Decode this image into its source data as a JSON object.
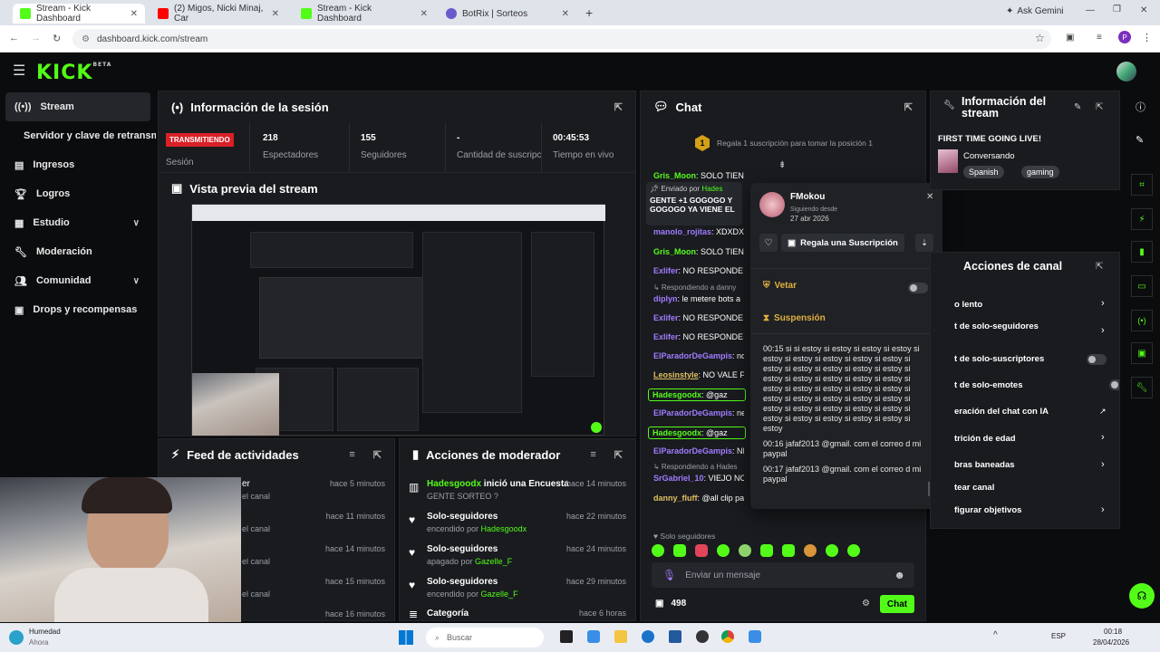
{
  "browser": {
    "tabs": [
      {
        "title": "Stream - Kick Dashboard",
        "color": "#53fc18"
      },
      {
        "title": "(2) Migos, Nicki Minaj, Car",
        "color": "#ff0000"
      },
      {
        "title": "Stream - Kick Dashboard",
        "color": "#53fc18"
      },
      {
        "title": "BotRix | Sorteos",
        "color": "#6a5acd"
      }
    ],
    "ask_gemini": "Ask Gemini",
    "url": "dashboard.kick.com/stream",
    "profile": "P"
  },
  "kick": {
    "logo": "KICK",
    "beta": "BETA"
  },
  "sidebar": {
    "items": [
      {
        "label": "Stream",
        "icon": "stream-icon"
      },
      {
        "label": "Servidor y clave de retransmisión",
        "icon": ""
      },
      {
        "label": "Ingresos",
        "icon": "chart-icon"
      },
      {
        "label": "Logros",
        "icon": "trophy-icon"
      },
      {
        "label": "Estudio",
        "icon": "studio-icon"
      },
      {
        "label": "Moderación",
        "icon": "wrench-icon"
      },
      {
        "label": "Comunidad",
        "icon": "people-icon"
      },
      {
        "label": "Drops y recompensas",
        "icon": "gift-icon"
      }
    ]
  },
  "session": {
    "title": "Información de la sesión",
    "live_badge": "TRANSMITIENDO",
    "session_label": "Sesión",
    "stats": [
      {
        "value": "218",
        "label": "Espectadores"
      },
      {
        "value": "155",
        "label": "Seguidores"
      },
      {
        "value": "-",
        "label": "Cantidad de suscripciones"
      },
      {
        "value": "00:45:53",
        "label": "Tiempo en vivo"
      }
    ]
  },
  "preview": {
    "title": "Vista previa del stream"
  },
  "feed": {
    "title": "Feed de actividades",
    "items": [
      {
        "l1": "er",
        "l2": "el canal",
        "time": "hace 5 minutos"
      },
      {
        "l1": "",
        "l2": "el canal",
        "time": "hace 11 minutos"
      },
      {
        "l1": "",
        "l2": "el canal",
        "time": "hace 14 minutos"
      },
      {
        "l1": "",
        "l2": "el canal",
        "time": "hace 15 minutos"
      },
      {
        "l1": "",
        "l2": "el canal",
        "time": "hace 16 minutos"
      }
    ]
  },
  "modactions": {
    "title": "Acciones de moderador",
    "items": [
      {
        "user": "Hadesgoodx",
        "action": " inició una Encuesta",
        "sub": "GENTE SORTEO ?",
        "subuser": "",
        "time": "hace 14 minutos"
      },
      {
        "user": "",
        "action": "Solo-seguidores",
        "sub": "encendido por ",
        "subuser": "Hadesgoodx",
        "time": "hace 22 minutos"
      },
      {
        "user": "",
        "action": "Solo-seguidores",
        "sub": "apagado por ",
        "subuser": "Gazelle_F",
        "time": "hace 24 minutos"
      },
      {
        "user": "",
        "action": "Solo-seguidores",
        "sub": "encendido por ",
        "subuser": "Gazelle_F",
        "time": "hace 29 minutos"
      },
      {
        "user": "",
        "action": "Categoría",
        "sub": "",
        "subuser": "",
        "time": "hace 6 horas"
      }
    ]
  },
  "chat": {
    "title": "Chat",
    "gift_rank": "1",
    "gift_text": "Regala 1 suscripción para tomar la posición 1",
    "pinned_by": "Enviado por",
    "pinned_user": "Hades",
    "pinned_msg1": "GENTE +1 GOGOGO Y",
    "pinned_msg2": "GOGOGO YA VIENE EL",
    "messages": [
      {
        "user": "Gris_Moon",
        "text": ": SOLO TIEN",
        "color": "#53fc18"
      },
      {
        "user": "manolo_rojitas",
        "text": ": XDXDX",
        "color": "#a17bff"
      },
      {
        "user": "Gris_Moon",
        "text": ": SOLO TIEN",
        "color": "#53fc18"
      },
      {
        "user": "Exlifer",
        "text": ": NO RESPONDE",
        "color": "#a17bff"
      },
      {
        "user": "↳ Respondiendo a danny",
        "text": "",
        "color": "#777"
      },
      {
        "user": "diplyn",
        "text": ": le metere bots a",
        "color": "#a17bff"
      },
      {
        "user": "Exlifer",
        "text": ": NO RESPONDE",
        "color": "#a17bff"
      },
      {
        "user": "Exlifer",
        "text": ": NO RESPONDE",
        "color": "#a17bff"
      },
      {
        "user": "ElParadorDeGampis",
        "text": ": no",
        "color": "#a17bff"
      },
      {
        "user": "Leosinstyle",
        "text": ": NO VALE F",
        "color": "#e0c060"
      },
      {
        "user": "Hadesgoodx",
        "text": ": @gaz",
        "color": "#53fc18"
      },
      {
        "user": "ElParadorDeGampis",
        "text": ": ne",
        "color": "#a17bff"
      },
      {
        "user": "Hadesgoodx",
        "text": ": @gaz",
        "color": "#53fc18"
      },
      {
        "user": "ElParadorDeGampis",
        "text": ": NI",
        "color": "#a17bff"
      },
      {
        "user": "↳ Respondiendo a Hades",
        "text": "",
        "color": "#777"
      },
      {
        "user": "SrGabriel_10",
        "text": ": VIEJO NO",
        "color": "#a17bff"
      },
      {
        "user": "danny_fluff",
        "text": ": @all clip pa",
        "color": "#e0c060"
      }
    ],
    "followers_only": "Solo seguidores",
    "input_placeholder": "Enviar un mensaje",
    "points": "498",
    "send": "Chat"
  },
  "usercard": {
    "name": "FMokou",
    "following_label": "Siguiendo desde",
    "following_date": "27 abr 2026",
    "gift_button": "Regala una Suscripción",
    "veto": "Vetar",
    "suspension": "Suspensión",
    "log": [
      {
        "text": "00:15 si si estoy si estoy si estoy si estoy si estoy si estoy si estoy si estoy si estoy si estoy si estoy si estoy si estoy si estoy si estoy si estoy si estoy si estoy si estoy si estoy si estoy si estoy si estoy si estoy si estoy si estoy si estoy si estoy si estoy si estoy si estoy si estoy si estoy si estoy si estoy si estoy si estoy si estoy si estoy si estoy"
      },
      {
        "text": "00:16 jafaf2013 @gmail. com el correo d mi paypal"
      },
      {
        "text": "00:17 jafaf2013 @gmail. com el correo d mi paypal"
      }
    ]
  },
  "streaminfo": {
    "title1": "Información del",
    "title2": "stream",
    "stream_title": "FIRST TIME GOING LIVE!",
    "category": "Conversando",
    "tags": [
      "Spanish",
      "gaming"
    ]
  },
  "channel": {
    "title": "Acciones de canal",
    "items": [
      {
        "label": "o lento",
        "ctrl": "chevron"
      },
      {
        "label": "t de solo-seguidores",
        "ctrl": "chevron"
      },
      {
        "label": "t de solo-suscriptores",
        "ctrl": "toggle"
      },
      {
        "label": "t de solo-emotes",
        "ctrl": "toggle"
      },
      {
        "label": "eración del chat con IA",
        "ctrl": "link"
      },
      {
        "label": "trición de edad",
        "ctrl": "chevron"
      },
      {
        "label": "bras baneadas",
        "ctrl": "chevron"
      },
      {
        "label": "tear canal",
        "ctrl": "none"
      },
      {
        "label": "figurar objetivos",
        "ctrl": "chevron"
      }
    ]
  },
  "taskbar": {
    "weather": "Humedad",
    "weather_sub": "Ahora",
    "search": "Buscar",
    "lang": "ESP",
    "time": "00:18",
    "date": "28/04/2026"
  }
}
